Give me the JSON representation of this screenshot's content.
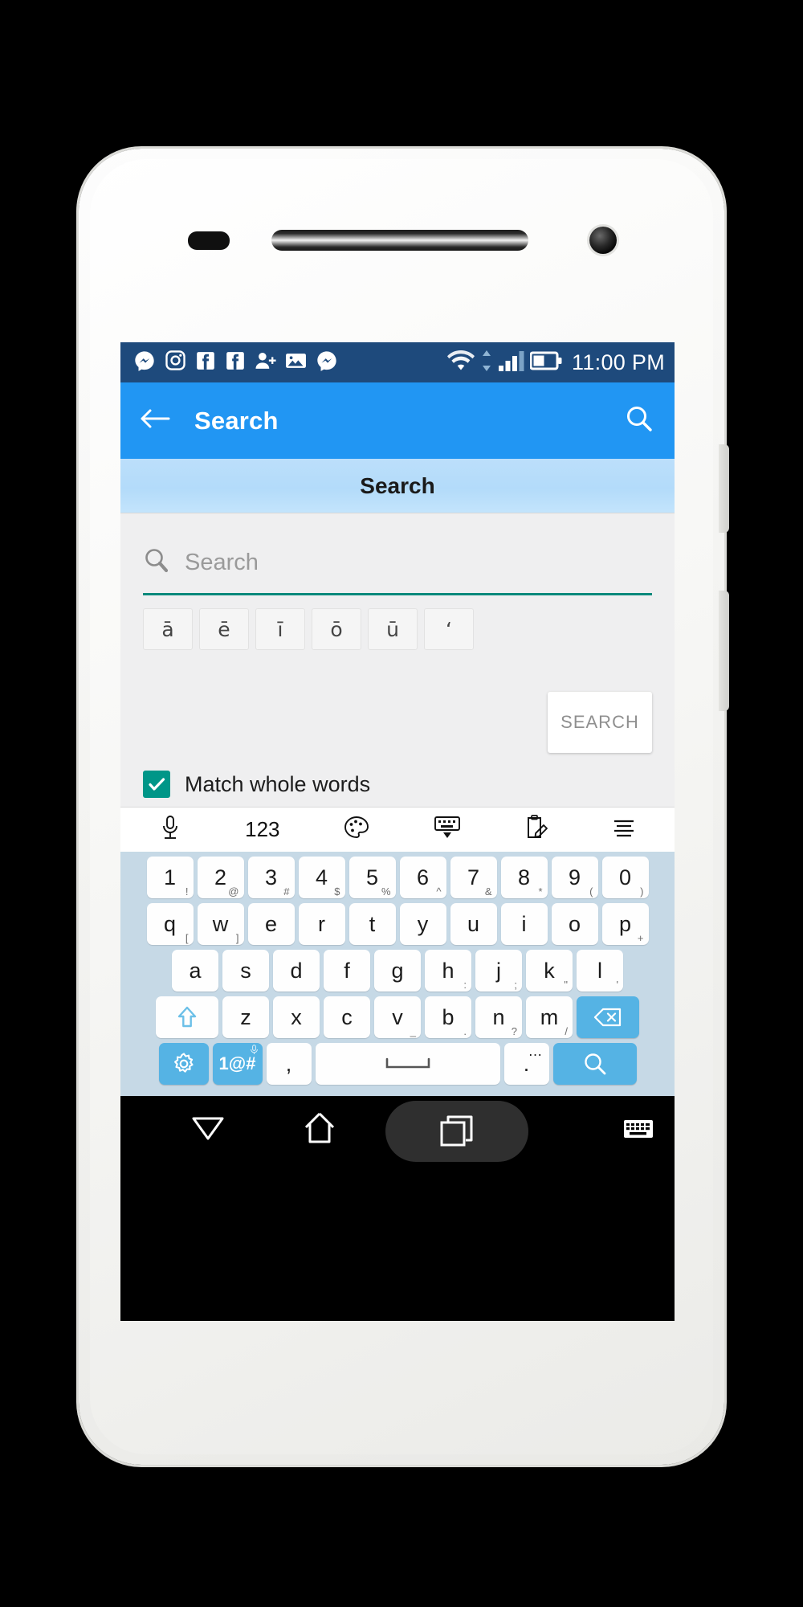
{
  "device": {
    "frame_color": "#f4f4f2",
    "hardware": {
      "earpiece": "earpiece-grille",
      "proximity_sensor": "sensor-slot",
      "front_camera": "front-camera",
      "volume_button": "volume-button",
      "power_button": "power-button"
    }
  },
  "status_bar": {
    "background": "#1e4a7c",
    "notification_icons": [
      "messenger-icon",
      "instagram-icon",
      "facebook-icon",
      "facebook-icon",
      "add-person-icon",
      "photo-icon",
      "messenger-icon"
    ],
    "system_icons": [
      "wifi-icon",
      "data-transfer-icon",
      "cell-signal-icon",
      "battery-icon"
    ],
    "time": "11:00 PM"
  },
  "app_bar": {
    "background": "#2196f3",
    "back_icon": "arrow-left-icon",
    "title": "Search",
    "action_icon": "search-icon"
  },
  "tab_bar": {
    "background": "#b3dbfa",
    "label": "Search"
  },
  "content": {
    "background": "#efeff0",
    "search": {
      "icon": "search-icon",
      "value": "",
      "placeholder": "Search",
      "underline_color": "#00897b"
    },
    "diacritic_keys": [
      "ā",
      "ē",
      "ī",
      "ō",
      "ū",
      "ʻ"
    ],
    "search_button_label": "SEARCH",
    "match_whole_words": {
      "label": "Match whole words",
      "checked": true,
      "checkbox_color": "#009688",
      "check_icon": "checkmark-icon"
    }
  },
  "keyboard_toolbar": {
    "background": "#ffffff",
    "items": [
      {
        "name": "microphone-icon",
        "label": ""
      },
      {
        "name": "numbers-toggle",
        "label": "123"
      },
      {
        "name": "theme-palette-icon",
        "label": ""
      },
      {
        "name": "hide-keyboard-icon",
        "label": ""
      },
      {
        "name": "clipboard-edit-icon",
        "label": ""
      },
      {
        "name": "keyboard-menu-icon",
        "label": ""
      }
    ]
  },
  "keyboard": {
    "background": "#c6d9e6",
    "key_color": "#fefefe",
    "accent_key_color": "#55b3e4",
    "rows": {
      "numbers": [
        {
          "main": "1",
          "sub": "!"
        },
        {
          "main": "2",
          "sub": "@"
        },
        {
          "main": "3",
          "sub": "#"
        },
        {
          "main": "4",
          "sub": "$"
        },
        {
          "main": "5",
          "sub": "%"
        },
        {
          "main": "6",
          "sub": "^"
        },
        {
          "main": "7",
          "sub": "&"
        },
        {
          "main": "8",
          "sub": "*"
        },
        {
          "main": "9",
          "sub": "("
        },
        {
          "main": "0",
          "sub": ")"
        }
      ],
      "top": [
        {
          "main": "q",
          "sub": "["
        },
        {
          "main": "w",
          "sub": "]"
        },
        {
          "main": "e",
          "sub": ""
        },
        {
          "main": "r",
          "sub": ""
        },
        {
          "main": "t",
          "sub": ""
        },
        {
          "main": "y",
          "sub": ""
        },
        {
          "main": "u",
          "sub": ""
        },
        {
          "main": "i",
          "sub": ""
        },
        {
          "main": "o",
          "sub": ""
        },
        {
          "main": "p",
          "sub": "+"
        }
      ],
      "home": [
        {
          "main": "a",
          "sub": ""
        },
        {
          "main": "s",
          "sub": ""
        },
        {
          "main": "d",
          "sub": ""
        },
        {
          "main": "f",
          "sub": ""
        },
        {
          "main": "g",
          "sub": ""
        },
        {
          "main": "h",
          "sub": ":"
        },
        {
          "main": "j",
          "sub": ";"
        },
        {
          "main": "k",
          "sub": "\""
        },
        {
          "main": "l",
          "sub": "'"
        }
      ],
      "bottom": [
        {
          "main": "z",
          "sub": ""
        },
        {
          "main": "x",
          "sub": ""
        },
        {
          "main": "c",
          "sub": ""
        },
        {
          "main": "v",
          "sub": "_"
        },
        {
          "main": "b",
          "sub": "."
        },
        {
          "main": "n",
          "sub": "?"
        },
        {
          "main": "m",
          "sub": "/"
        }
      ],
      "shift_key": "shift-icon",
      "backspace_key": "backspace-icon",
      "space_row": {
        "settings_key": "gear-icon",
        "symbols_key": "1@#",
        "symbols_sup": "mic-small-icon",
        "comma_key": ",",
        "space_key": "space-icon",
        "period_key": ".",
        "period_sup": "…",
        "enter_key": "search-icon"
      }
    }
  },
  "nav_bar": {
    "background": "#000000",
    "back_icon": "triangle-down-icon",
    "home_icon": "home-icon",
    "recents_icon": "recents-icon",
    "recents_highlighted": true,
    "keyboard_icon": "keyboard-indicator-icon"
  }
}
